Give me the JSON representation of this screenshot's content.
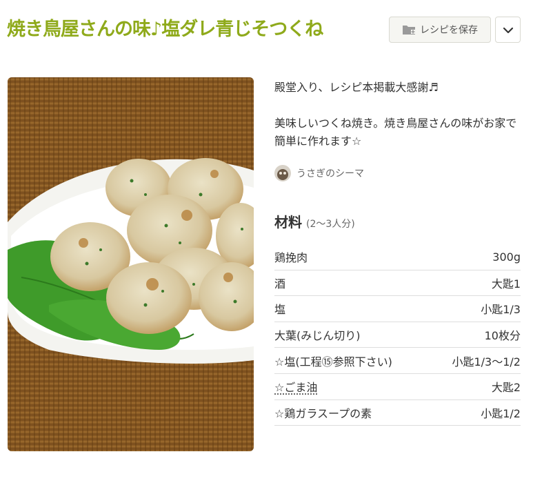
{
  "recipe": {
    "title": "焼き鳥屋さんの味♪塩ダレ青じそつくね",
    "save_label": "レシピを保存",
    "description_1": "殿堂入り、レシピ本掲載大感謝♬",
    "description_2": "美味しいつくね焼き。焼き鳥屋さんの味がお家で簡単に作れます☆",
    "author": "うさぎのシーマ",
    "ingredients_title": "材料",
    "servings": "(2～3人分)",
    "ingredients": [
      {
        "name": "鶏挽肉",
        "quantity": "300g"
      },
      {
        "name": "酒",
        "quantity": "大匙1"
      },
      {
        "name": "塩",
        "quantity": "小匙1/3"
      },
      {
        "name": "大葉(みじん切り)",
        "quantity": "10枚分"
      },
      {
        "name": "☆塩(工程⑮参照下さい)",
        "quantity": "小匙1/3～1/2"
      },
      {
        "name": "☆ごま油",
        "quantity": "大匙2"
      },
      {
        "name": "☆鶏ガラスープの素",
        "quantity": "小匙1/2"
      }
    ]
  },
  "icons": {
    "save": "folder-plus-icon",
    "more": "chevron-down-icon"
  },
  "colors": {
    "title": "#8faa1b",
    "button_bg": "#f6f6f2",
    "divider": "#dddddd"
  }
}
